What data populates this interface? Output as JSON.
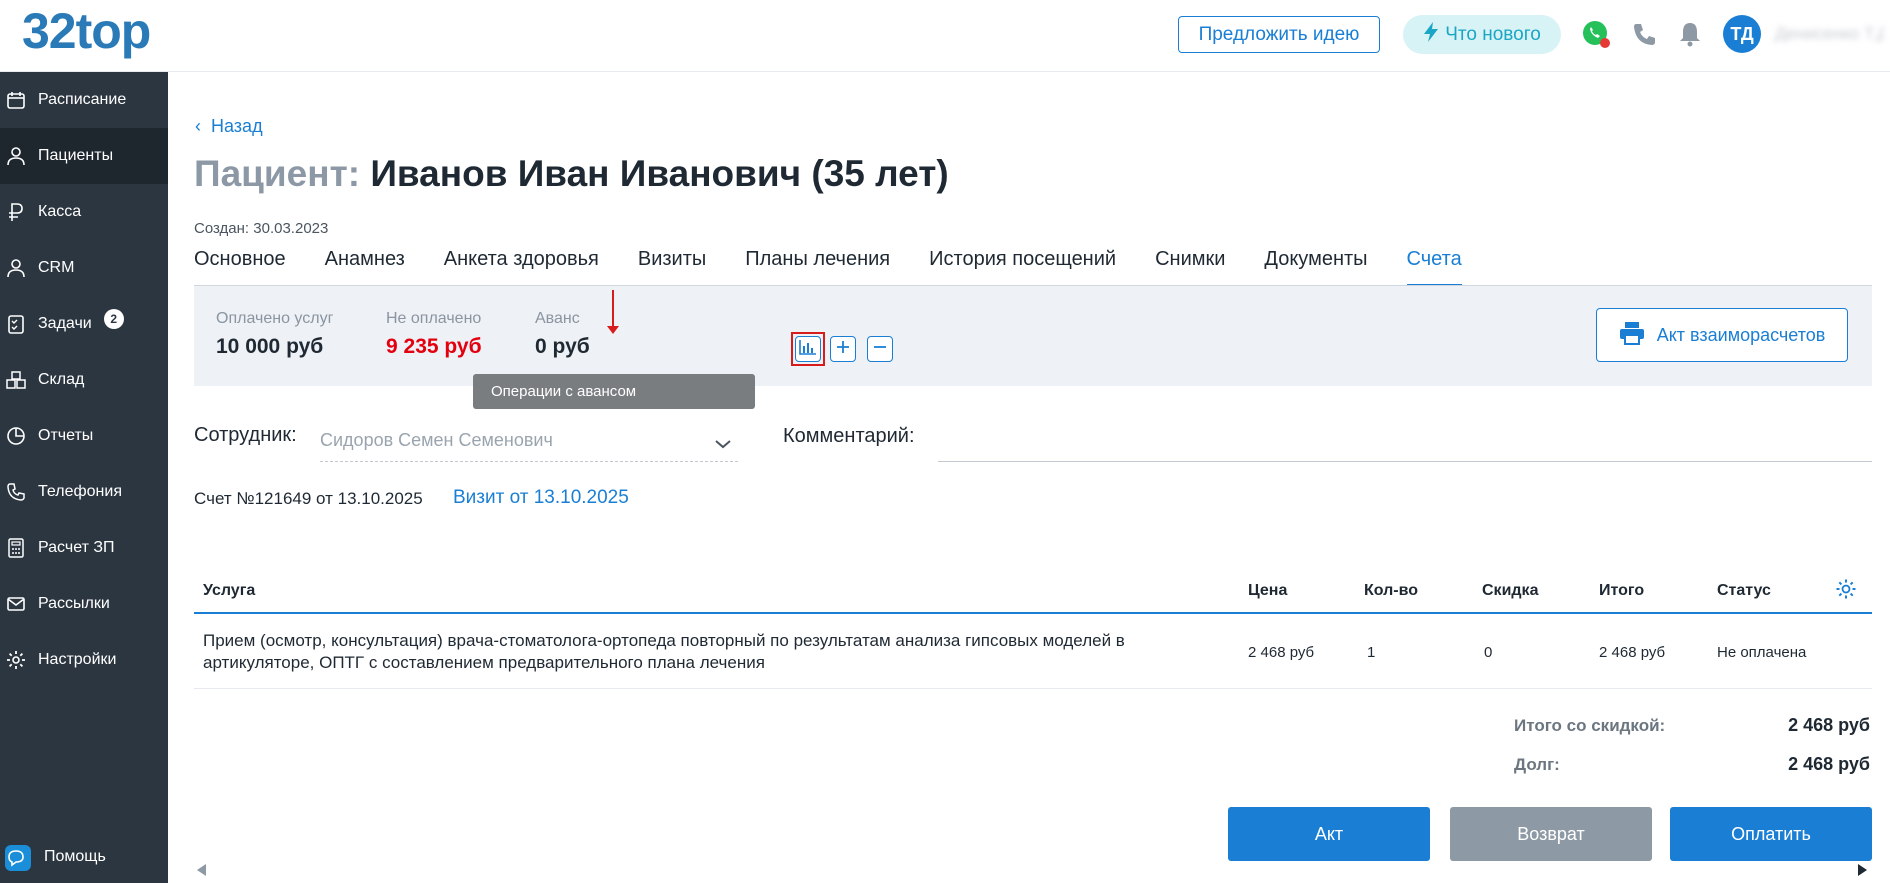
{
  "header": {
    "logo": "32top",
    "suggest_idea": "Предложить идею",
    "whats_new": "Что нового",
    "avatar_initials": "ТД",
    "user_name": "Денисенко Т.Д."
  },
  "sidebar": {
    "items": [
      {
        "label": "Расписание",
        "icon": "calendar-icon"
      },
      {
        "label": "Пациенты",
        "icon": "user-icon",
        "active": true
      },
      {
        "label": "Касса",
        "icon": "ruble-icon"
      },
      {
        "label": "CRM",
        "icon": "user-icon"
      },
      {
        "label": "Задачи",
        "icon": "tasks-icon",
        "badge": "2"
      },
      {
        "label": "Склад",
        "icon": "boxes-icon"
      },
      {
        "label": "Отчеты",
        "icon": "pie-chart-icon"
      },
      {
        "label": "Телефония",
        "icon": "phone-icon"
      },
      {
        "label": "Расчет ЗП",
        "icon": "calculator-icon"
      },
      {
        "label": "Рассылки",
        "icon": "mail-icon"
      },
      {
        "label": "Настройки",
        "icon": "gear-icon"
      }
    ],
    "help": "Помощь"
  },
  "page": {
    "back": "Назад",
    "title_label": "Пациент:",
    "title_name": "Иванов Иван Иванович (35 лет)",
    "created": "Создан: 30.03.2023",
    "tabs": [
      "Основное",
      "Анамнез",
      "Анкета здоровья",
      "Визиты",
      "Планы лечения",
      "История посещений",
      "Снимки",
      "Документы",
      "Счета"
    ],
    "active_tab": "Счета"
  },
  "summary": {
    "paid_label": "Оплачено услуг",
    "paid_value": "10 000 руб",
    "unpaid_label": "Не оплачено",
    "unpaid_value": "9 235 руб",
    "advance_label": "Аванс",
    "advance_value": "0 руб",
    "tooltip": "Операции с авансом",
    "act_button": "Акт взаиморасчетов"
  },
  "form": {
    "employee_label": "Сотрудник:",
    "employee_value": "Сидоров Семен Семенович",
    "comment_label": "Комментарий:",
    "invoice": "Счет №121649 от 13.10.2025",
    "visit_link": "Визит от 13.10.2025"
  },
  "table": {
    "headers": {
      "service": "Услуга",
      "price": "Цена",
      "qty": "Кол-во",
      "discount": "Скидка",
      "total": "Итого",
      "status": "Статус"
    },
    "rows": [
      {
        "service": "Прием (осмотр, консультация) врача-стоматолога-ортопеда повторный по результатам анализа гипсовых моделей в артикуляторе, ОПТГ с составлением предварительного плана лечения",
        "price": "2 468 руб",
        "qty": "1",
        "discount": "0",
        "total": "2 468 руб",
        "status": "Не оплачена"
      }
    ]
  },
  "totals": {
    "with_discount_label": "Итого со скидкой:",
    "with_discount_value": "2 468 руб",
    "debt_label": "Долг:",
    "debt_value": "2 468 руб"
  },
  "actions": {
    "act": "Акт",
    "refund": "Возврат",
    "pay": "Оплатить"
  },
  "colors": {
    "accent": "#1a7fd4",
    "sidebar": "#2c3640",
    "unpaid": "#e3000f",
    "disabled": "#8d99a5"
  }
}
